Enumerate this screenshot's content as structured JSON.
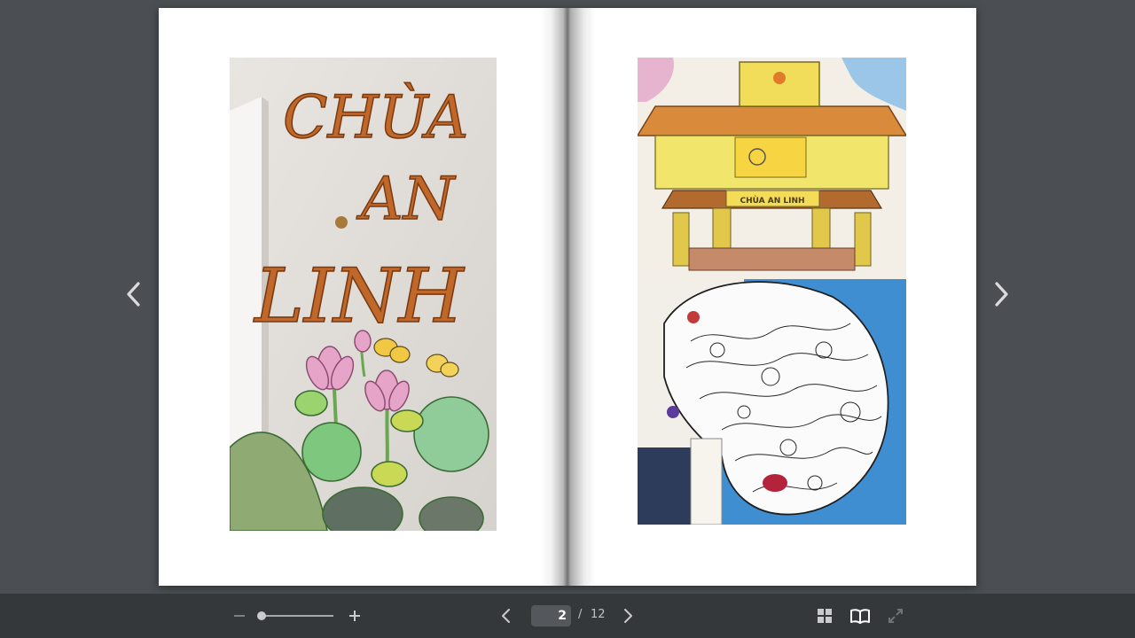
{
  "viewer": {
    "current_page": "2",
    "page_separator": "/",
    "total_pages": "12"
  },
  "pages": {
    "left": {
      "photo_text_lines": [
        "CHÙA",
        "AN",
        "LINH"
      ]
    },
    "right": {
      "sign_text": "CHÙA AN LINH"
    }
  },
  "icons": {
    "prev_spread": "chevron-left-icon",
    "next_spread": "chevron-right-icon",
    "zoom_out": "minus-icon",
    "zoom_in": "plus-icon",
    "prev_page": "chevron-left-icon",
    "next_page": "chevron-right-icon",
    "thumbnails": "grid-icon",
    "book_view": "open-book-icon",
    "fullscreen": "expand-icon"
  },
  "zoom": {
    "level": 0
  },
  "colors": {
    "background": "#4b4f53",
    "toolbar": "#35383b",
    "icon": "#c9cbcd",
    "active_icon": "#ffffff"
  }
}
